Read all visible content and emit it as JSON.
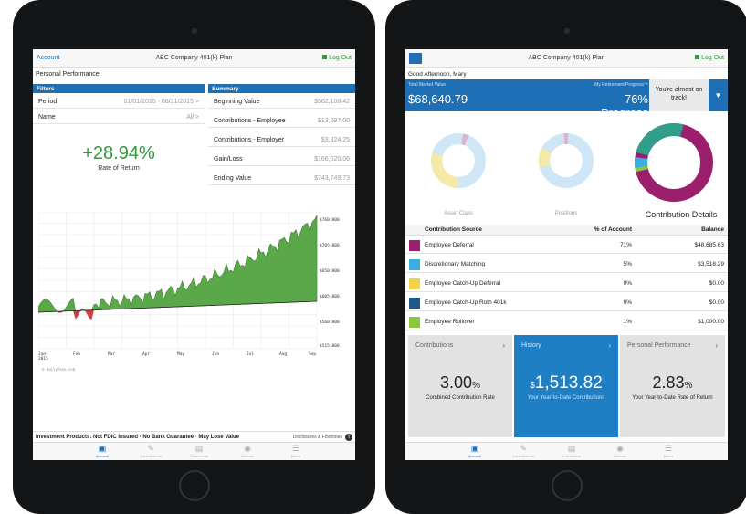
{
  "left": {
    "header": {
      "left_link": "Account",
      "title": "ABC Company 401(k) Plan",
      "logout": "Log Out"
    },
    "page_title": "Personal Performance",
    "filters": {
      "heading": "Filters",
      "rows": [
        {
          "label": "Period",
          "value": "01/01/2015 - 08/31/2015 >"
        },
        {
          "label": "Name",
          "value": "All >"
        }
      ]
    },
    "rate": {
      "value": "+28.94%",
      "label": "Rate of Return"
    },
    "summary": {
      "heading": "Summary",
      "rows": [
        {
          "label": "Beginning Value",
          "value": "$562,108.42"
        },
        {
          "label": "Contributions - Employee",
          "value": "$13,297.00"
        },
        {
          "label": "Contributions - Employer",
          "value": "$3,324.25"
        },
        {
          "label": "Gain/Loss",
          "value": "$166,020.06"
        },
        {
          "label": "Ending Value",
          "value": "$743,749.73"
        }
      ]
    },
    "chart": {
      "months": [
        "Jan",
        "Feb",
        "Mar",
        "Apr",
        "May",
        "Jun",
        "Jul",
        "Aug",
        "Sep"
      ],
      "year": "2015",
      "y_ticks": [
        "$760,000",
        "$705,000",
        "$650,000",
        "$605,000",
        "$560,000",
        "$515,000"
      ],
      "watermark": "© dailyfxeo.com",
      "colors": {
        "gain": "#5aa84a",
        "loss": "#c94040",
        "line": "#222222"
      }
    },
    "disclaimer": "Investment Products: Not FDIC Insured · No Bank Guarantee · May Lose Value",
    "disclosures": "Disclosures & Footnotes",
    "tabs": [
      {
        "label": "Account",
        "icon": "account-icon",
        "active": true
      },
      {
        "label": "Contributions",
        "icon": "contributions-icon",
        "active": false
      },
      {
        "label": "Statements",
        "icon": "statements-icon",
        "active": false
      },
      {
        "label": "Markets",
        "icon": "markets-icon",
        "active": false
      },
      {
        "label": "Menu",
        "icon": "menu-icon",
        "active": false
      }
    ]
  },
  "right": {
    "header": {
      "title": "ABC Company 401(k) Plan",
      "logout": "Log Out"
    },
    "greeting": "Good Afternoon, Mary",
    "market_value": {
      "label": "Total Market Value",
      "value": "$68,640.79"
    },
    "retirement": {
      "label": "My Retirement Progress™",
      "value": "76% Progress"
    },
    "on_track": "You're almost on track!",
    "donuts": [
      {
        "label": "Asset Class"
      },
      {
        "label": "Positions"
      },
      {
        "label": "Contribution Details"
      }
    ],
    "table": {
      "headers": [
        "Contribution Source",
        "% of Account",
        "Balance"
      ],
      "rows": [
        {
          "name": "Employee Deferral",
          "pct": "71%",
          "balance": "$48,685.63",
          "color": "#9c1f6e"
        },
        {
          "name": "Discretionary Matching",
          "pct": "5%",
          "balance": "$3,518.29",
          "color": "#3aaee0"
        },
        {
          "name": "Employee Catch-Up Deferral",
          "pct": "0%",
          "balance": "$0.00",
          "color": "#f2d24a"
        },
        {
          "name": "Employee Catch-Up Roth 401k",
          "pct": "0%",
          "balance": "$0.00",
          "color": "#1d5a8a"
        },
        {
          "name": "Employee Rollover",
          "pct": "1%",
          "balance": "$1,000.00",
          "color": "#8cc63f"
        }
      ]
    },
    "cards": [
      {
        "title": "Contributions",
        "value": "3.00",
        "unit": "%",
        "prefix": "",
        "sub": "Combined Contribution Rate"
      },
      {
        "title": "History",
        "value": "1,513.82",
        "unit": "",
        "prefix": "$",
        "sub": "Your Year-to-Date Contributions"
      },
      {
        "title": "Personal Performance",
        "value": "2.83",
        "unit": "%",
        "prefix": "",
        "sub": "Your Year-to-Date Rate of Return"
      }
    ],
    "tabs": [
      {
        "label": "Account",
        "icon": "account-icon",
        "active": true
      },
      {
        "label": "Contributions",
        "icon": "contributions-icon",
        "active": false
      },
      {
        "label": "Investment",
        "icon": "investment-icon",
        "active": false
      },
      {
        "label": "Markets",
        "icon": "markets-icon",
        "active": false
      },
      {
        "label": "Menu",
        "icon": "menu-icon",
        "active": false
      }
    ]
  }
}
